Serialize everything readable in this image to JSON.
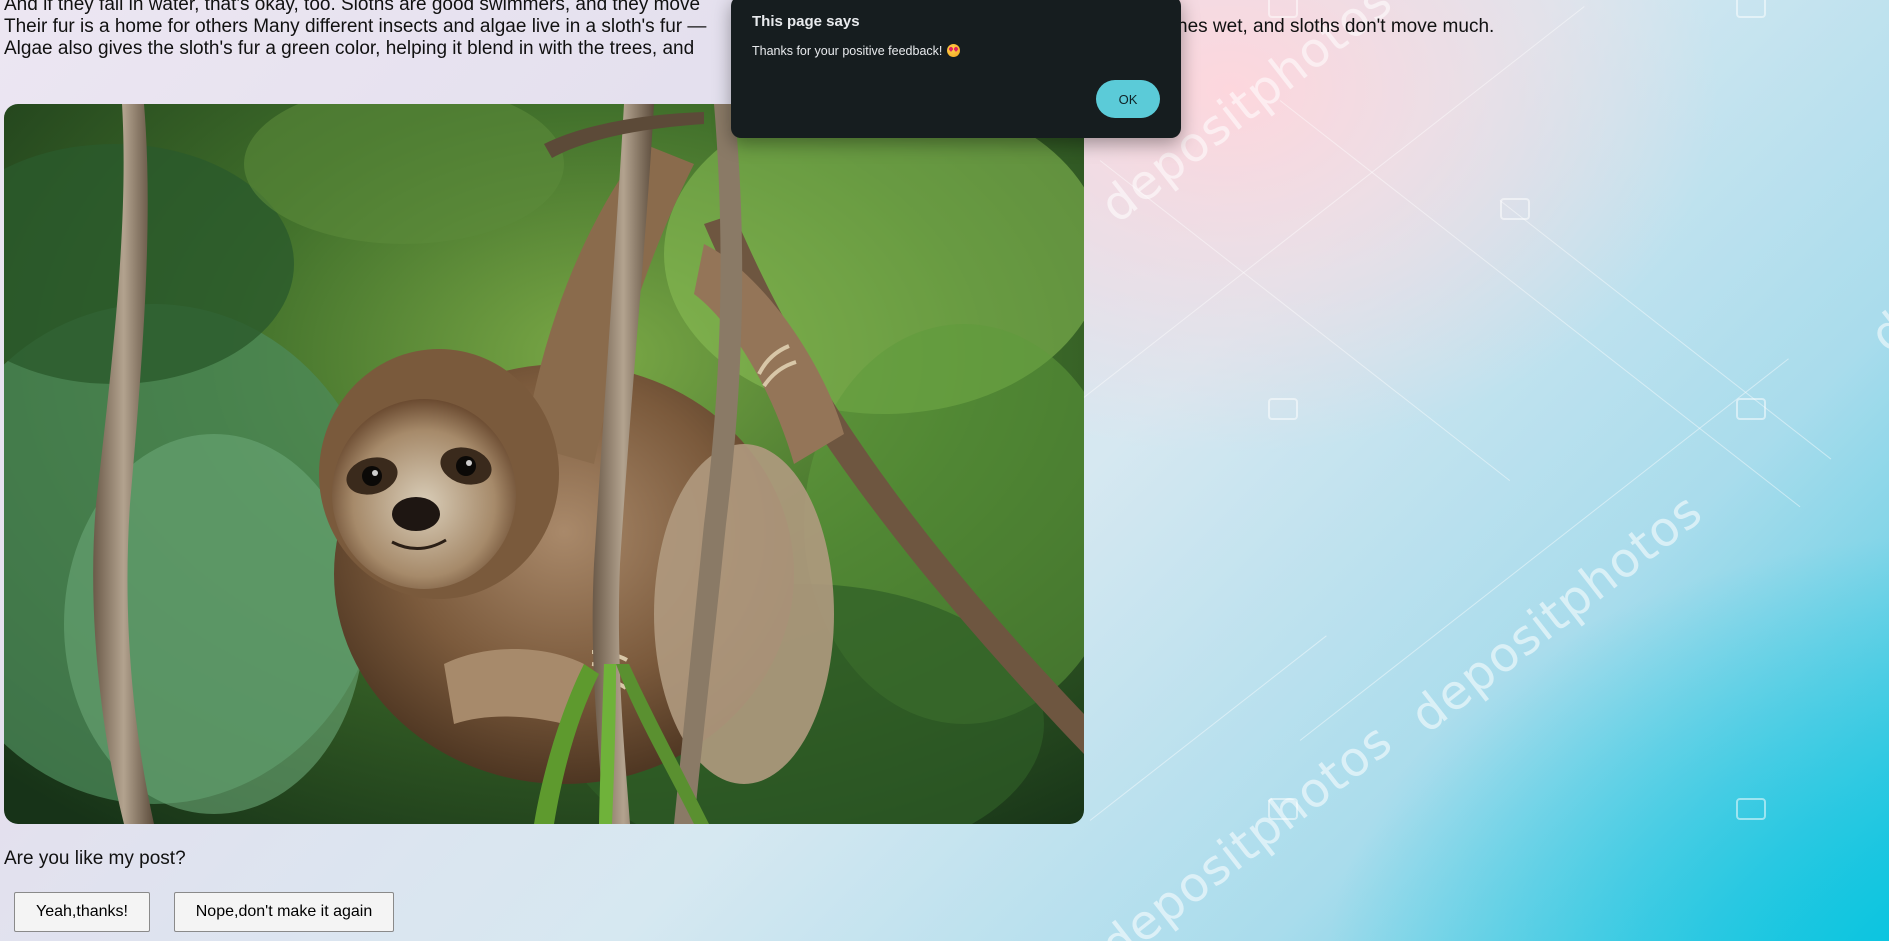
{
  "article": {
    "line1": "And if they fall in water, that's okay, too. Sloths are good swimmers, and they move",
    "line2": "Their fur is a home for others Many different insects and algae live in a sloth's fur —",
    "line2_tail": "nes wet, and sloths don't move much.",
    "line3": "Algae also gives the sloth's fur a green color, helping it blend in with the trees, and"
  },
  "image": {
    "alt": "sloth hanging from a branch"
  },
  "feedback": {
    "question": "Are you like my post?",
    "yes_label": "Yeah,thanks!",
    "no_label": "Nope,don't make it again"
  },
  "dialog": {
    "title": "This page says",
    "message": "Thanks for your positive feedback!",
    "ok_label": "OK"
  },
  "watermark": {
    "text": "depositphotos"
  },
  "colors": {
    "dialog_bg": "#161d1f",
    "ok_button": "#5bcbd8"
  }
}
